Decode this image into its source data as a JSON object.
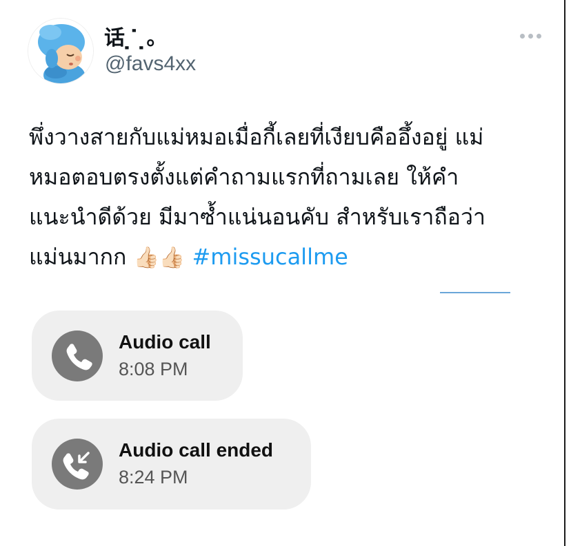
{
  "header": {
    "display_name": "话 ̣  ̇  ̣。",
    "handle": "@favs4xx",
    "more_icon": "more-horizontal-icon"
  },
  "tweet": {
    "lines": [
      "พึ่งวางสายกับแม่หมอเมื่อกี้เลยที่เงียบคืออึ้งอยู่ แม่",
      "หมอตอบตรงตั้งแต่คำถามแรกที่ถามเลย ให้คำ",
      "แนะนำดีด้วย มีมาซ้ำแน่นอนคับ สำหรับเราถือว่า",
      "แม่นมากก"
    ],
    "emoji": "👍🏻👍🏻",
    "hashtag": "#missucallme",
    "hashtag_color": "#1d9bf0"
  },
  "calls": [
    {
      "title": "Audio call",
      "time": "8:08 PM",
      "icon": "phone-icon"
    },
    {
      "title": "Audio call ended",
      "time": "8:24 PM",
      "icon": "phone-incoming-icon"
    }
  ],
  "colors": {
    "text": "#0f1419",
    "muted": "#536471",
    "card_bg": "#efefef",
    "icon_bg": "#7a7a7a"
  }
}
